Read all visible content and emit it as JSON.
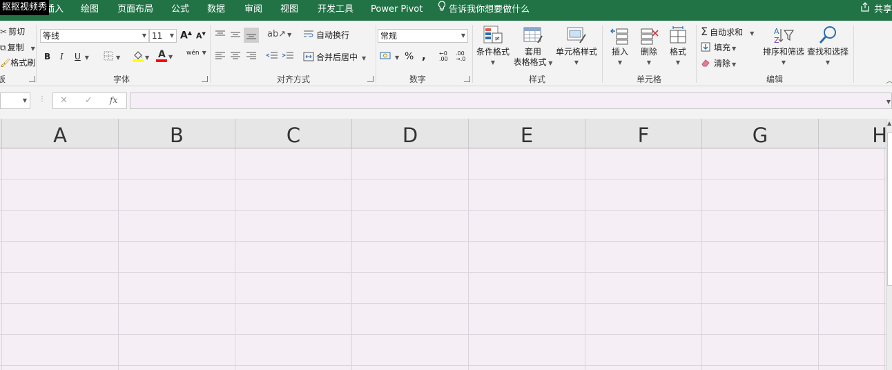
{
  "watermark": "抠抠视频秀",
  "menu": {
    "tabs": [
      "插入",
      "绘图",
      "页面布局",
      "公式",
      "数据",
      "审阅",
      "视图",
      "开发工具",
      "Power Pivot"
    ],
    "tell_me": "告诉我你想要做什么",
    "share": "共享"
  },
  "clipboard": {
    "cut": "剪切",
    "copy": "复制",
    "format_painter": "格式刷",
    "label": "剪贴板"
  },
  "font": {
    "name": "等线",
    "size": "11",
    "grow_label": "A",
    "shrink_label": "A",
    "bold": "B",
    "italic": "I",
    "underline": "U",
    "font_color_letter": "A",
    "phonetic": "wén",
    "label": "字体"
  },
  "alignment": {
    "wrap_text": "自动换行",
    "merge_center": "合并后居中",
    "label": "对齐方式"
  },
  "number": {
    "format": "常规",
    "percent": "%",
    "comma": ",",
    "label": "数字"
  },
  "styles": {
    "conditional": "条件格式",
    "table_format_line1": "套用",
    "table_format_line2": "表格格式",
    "cell_styles": "单元格样式",
    "label": "样式"
  },
  "cells": {
    "insert": "插入",
    "delete": "删除",
    "format": "格式",
    "label": "单元格"
  },
  "editing": {
    "autosum": "自动求和",
    "fill": "填充",
    "clear": "清除",
    "sort_filter": "排序和筛选",
    "find_select": "查找和选择",
    "label": "编辑"
  },
  "formula_bar": {
    "cancel": "✕",
    "enter": "✓",
    "fx": "fx",
    "value": ""
  },
  "columns": [
    "A",
    "B",
    "C",
    "D",
    "E",
    "F",
    "G",
    "H"
  ],
  "colors": {
    "brand_green": "#217346",
    "grid_bg": "#f5eef5",
    "highlight_yellow": "#ffff00",
    "font_red": "#ff0000"
  }
}
